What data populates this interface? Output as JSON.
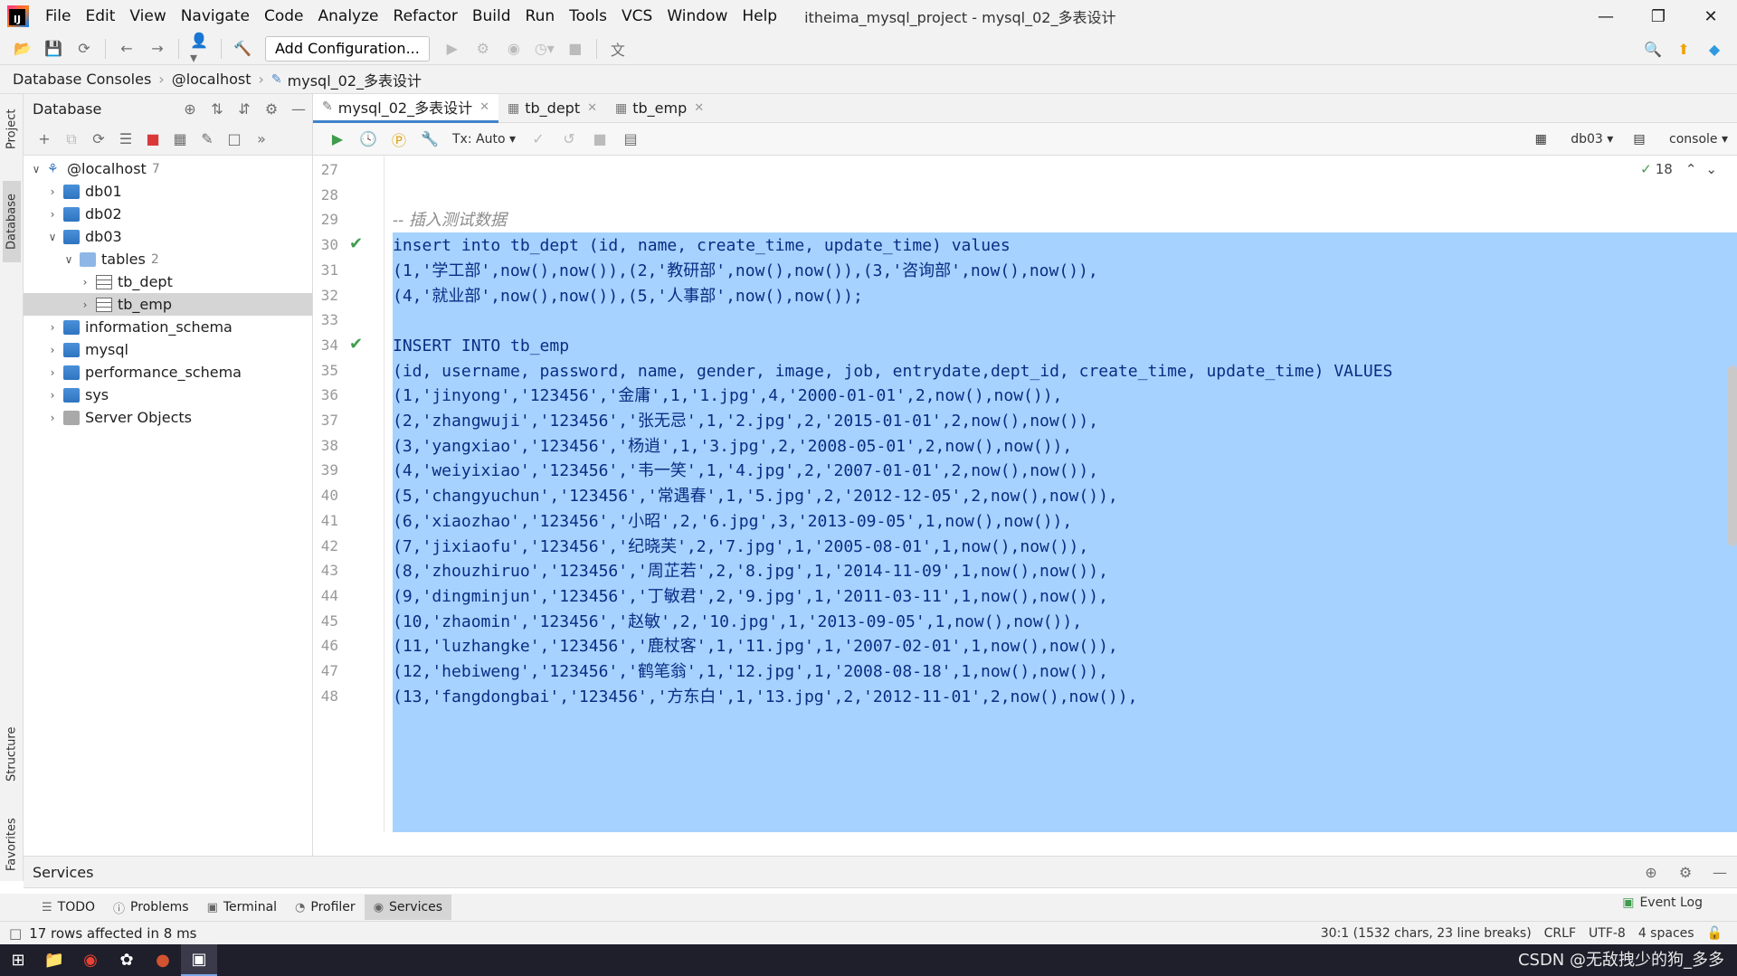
{
  "menubar": {
    "items": [
      "File",
      "Edit",
      "View",
      "Navigate",
      "Code",
      "Analyze",
      "Refactor",
      "Build",
      "Run",
      "Tools",
      "VCS",
      "Window",
      "Help"
    ],
    "title": "itheima_mysql_project - mysql_02_多表设计"
  },
  "toolbar": {
    "add_config_label": "Add Configuration..."
  },
  "breadcrumb": [
    "Database Consoles",
    "@localhost",
    "mysql_02_多表设计"
  ],
  "left_stripe": {
    "project": "Project",
    "database": "Database",
    "structure": "Structure",
    "favorites": "Favorites"
  },
  "db_panel": {
    "title": "Database",
    "tree": [
      {
        "label": "@localhost",
        "count": "7",
        "level": 0,
        "expanded": true,
        "kind": "host"
      },
      {
        "label": "db01",
        "level": 1,
        "expanded": false,
        "kind": "db"
      },
      {
        "label": "db02",
        "level": 1,
        "expanded": false,
        "kind": "db"
      },
      {
        "label": "db03",
        "level": 1,
        "expanded": true,
        "kind": "db"
      },
      {
        "label": "tables",
        "count": "2",
        "level": 2,
        "expanded": true,
        "kind": "folder"
      },
      {
        "label": "tb_dept",
        "level": 3,
        "expanded": false,
        "kind": "table"
      },
      {
        "label": "tb_emp",
        "level": 3,
        "expanded": false,
        "kind": "table",
        "selected": true
      },
      {
        "label": "information_schema",
        "level": 1,
        "expanded": false,
        "kind": "db"
      },
      {
        "label": "mysql",
        "level": 1,
        "expanded": false,
        "kind": "db"
      },
      {
        "label": "performance_schema",
        "level": 1,
        "expanded": false,
        "kind": "db"
      },
      {
        "label": "sys",
        "level": 1,
        "expanded": false,
        "kind": "db"
      },
      {
        "label": "Server Objects",
        "level": 1,
        "expanded": false,
        "kind": "server"
      }
    ]
  },
  "editor": {
    "tabs": [
      {
        "label": "mysql_02_多表设计",
        "active": true
      },
      {
        "label": "tb_dept",
        "active": false
      },
      {
        "label": "tb_emp",
        "active": false
      }
    ],
    "tx_mode": "Tx: Auto",
    "schema": "db03",
    "session": "console",
    "inspection_count": "18",
    "lines": [
      {
        "n": "27",
        "text": "",
        "ok": false
      },
      {
        "n": "28",
        "text": "",
        "ok": false
      },
      {
        "n": "29",
        "text": "-- 插入测试数据",
        "ok": false,
        "comment": true
      },
      {
        "n": "30",
        "text": "insert into tb_dept (id, name, create_time, update_time) values",
        "ok": true
      },
      {
        "n": "31",
        "text": "(1,'学工部',now(),now()),(2,'教研部',now(),now()),(3,'咨询部',now(),now()),",
        "ok": false
      },
      {
        "n": "32",
        "text": "(4,'就业部',now(),now()),(5,'人事部',now(),now());",
        "ok": false
      },
      {
        "n": "33",
        "text": "",
        "ok": false
      },
      {
        "n": "34",
        "text": "INSERT INTO tb_emp",
        "ok": true
      },
      {
        "n": "35",
        "text": "(id, username, password, name, gender, image, job, entrydate,dept_id, create_time, update_time) VALUES",
        "ok": false
      },
      {
        "n": "36",
        "text": "(1,'jinyong','123456','金庸',1,'1.jpg',4,'2000-01-01',2,now(),now()),",
        "ok": false
      },
      {
        "n": "37",
        "text": "(2,'zhangwuji','123456','张无忌',1,'2.jpg',2,'2015-01-01',2,now(),now()),",
        "ok": false
      },
      {
        "n": "38",
        "text": "(3,'yangxiao','123456','杨逍',1,'3.jpg',2,'2008-05-01',2,now(),now()),",
        "ok": false
      },
      {
        "n": "39",
        "text": "(4,'weiyixiao','123456','韦一笑',1,'4.jpg',2,'2007-01-01',2,now(),now()),",
        "ok": false
      },
      {
        "n": "40",
        "text": "(5,'changyuchun','123456','常遇春',1,'5.jpg',2,'2012-12-05',2,now(),now()),",
        "ok": false
      },
      {
        "n": "41",
        "text": "(6,'xiaozhao','123456','小昭',2,'6.jpg',3,'2013-09-05',1,now(),now()),",
        "ok": false
      },
      {
        "n": "42",
        "text": "(7,'jixiaofu','123456','纪晓芙',2,'7.jpg',1,'2005-08-01',1,now(),now()),",
        "ok": false
      },
      {
        "n": "43",
        "text": "(8,'zhouzhiruo','123456','周芷若',2,'8.jpg',1,'2014-11-09',1,now(),now()),",
        "ok": false
      },
      {
        "n": "44",
        "text": "(9,'dingminjun','123456','丁敏君',2,'9.jpg',1,'2011-03-11',1,now(),now()),",
        "ok": false
      },
      {
        "n": "45",
        "text": "(10,'zhaomin','123456','赵敏',2,'10.jpg',1,'2013-09-05',1,now(),now()),",
        "ok": false
      },
      {
        "n": "46",
        "text": "(11,'luzhangke','123456','鹿杖客',1,'11.jpg',1,'2007-02-01',1,now(),now()),",
        "ok": false
      },
      {
        "n": "47",
        "text": "(12,'hebiweng','123456','鹤笔翁',1,'12.jpg',1,'2008-08-18',1,now(),now()),",
        "ok": false
      },
      {
        "n": "48",
        "text": "(13,'fangdongbai','123456','方东白',1,'13.jpg',2,'2012-11-01',2,now(),now()),",
        "ok": false
      }
    ]
  },
  "services": {
    "title": "Services"
  },
  "tool_tabs": [
    {
      "label": "TODO",
      "active": false
    },
    {
      "label": "Problems",
      "active": false
    },
    {
      "label": "Terminal",
      "active": false
    },
    {
      "label": "Profiler",
      "active": false
    },
    {
      "label": "Services",
      "active": true
    }
  ],
  "event_log": "Event Log",
  "status": {
    "message": "17 rows affected in 8 ms",
    "position": "30:1 (1532 chars, 23 line breaks)",
    "line_sep": "CRLF",
    "encoding": "UTF-8",
    "indent": "4 spaces"
  },
  "taskbar": {
    "watermark": "CSDN @无敌拽少的狗_多多"
  },
  "colors": {
    "selection": "#a6d2ff",
    "ok_green": "#3f9c4d",
    "keyword": "#0a2d83"
  }
}
